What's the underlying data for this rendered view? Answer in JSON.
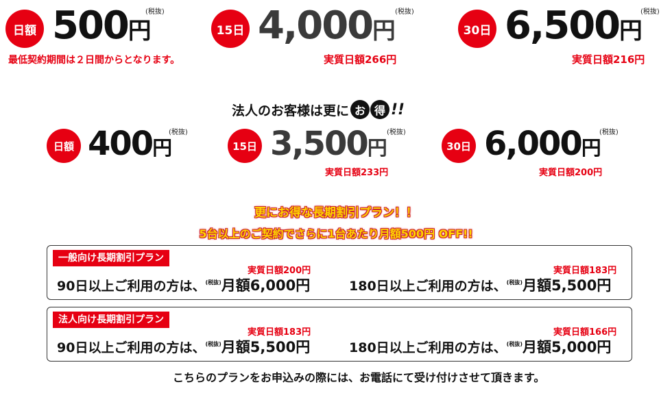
{
  "individual": {
    "day": {
      "badge": "日額",
      "price": "500",
      "unit": "円",
      "tax": "(税抜)",
      "note": "最低契約期間は２日間からとなります。"
    },
    "d15": {
      "badge": "15日",
      "price": "4,000",
      "unit": "円",
      "tax": "(税抜)",
      "note": "実質日額266円"
    },
    "d30": {
      "badge": "30日",
      "price": "6,500",
      "unit": "円",
      "tax": "(税抜)",
      "note": "実質日額216円"
    }
  },
  "corporate": {
    "heading_text": "法人のお客様は更に",
    "heading_o": "お",
    "heading_toku": "得",
    "heading_bang": "!!",
    "day": {
      "badge": "日額",
      "price": "400",
      "unit": "円",
      "tax": "(税抜)"
    },
    "d15": {
      "badge": "15日",
      "price": "3,500",
      "unit": "円",
      "tax": "(税抜)",
      "note": "実質日額233円"
    },
    "d30": {
      "badge": "30日",
      "price": "6,000",
      "unit": "円",
      "tax": "(税抜)",
      "note": "実質日額200円"
    }
  },
  "promo": {
    "line1": "更にお得な長期割引プラン！！",
    "line2": "5台以上のご契約でさらに1台あたり月額500円 OFF!!"
  },
  "general_plan": {
    "label": "一般向け長期割引プラン",
    "left": {
      "note": "実質日額200円",
      "prefix": "90日以上ご利用の方は、",
      "tax": "(税抜)",
      "amount": "月額6,000円"
    },
    "right": {
      "note": "実質日額183円",
      "prefix": "180日以上ご利用の方は、",
      "tax": "(税抜)",
      "amount": "月額5,500円"
    }
  },
  "corp_plan": {
    "label": "法人向け長期割引プラン",
    "left": {
      "note": "実質日額183円",
      "prefix": "90日以上ご利用の方は、",
      "tax": "(税抜)",
      "amount": "月額5,500円"
    },
    "right": {
      "note": "実質日額166円",
      "prefix": "180日以上ご利用の方は、",
      "tax": "(税抜)",
      "amount": "月額5,000円"
    }
  },
  "footer_note": "こちらのプランをお申込みの際には、お電話にて受け付けさせて頂きます。",
  "colors": {
    "accent": "#e60012",
    "promo_fill": "#ffd400",
    "price_dark": "#111111",
    "price_mid": "#3a3a3a"
  }
}
